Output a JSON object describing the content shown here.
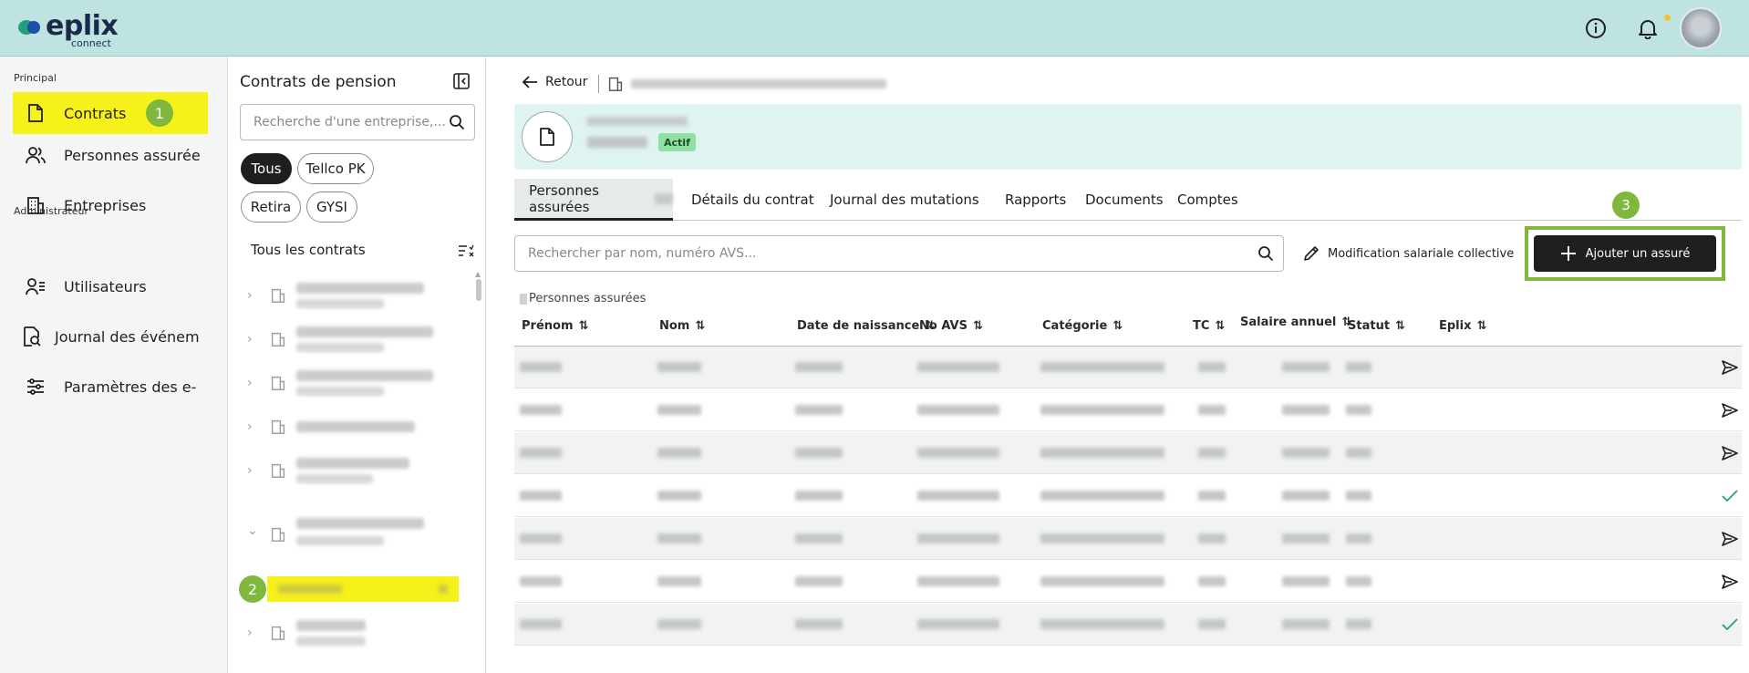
{
  "header": {
    "brand_name": "eplix",
    "brand_sub": "connect",
    "icons": [
      "info-icon",
      "bell-icon",
      "user-avatar"
    ]
  },
  "sidebar": {
    "sections": [
      {
        "label": "Principal"
      },
      {
        "label": "Administrateur"
      }
    ],
    "items": [
      {
        "label": "Contrats",
        "icon": "document-icon",
        "active": true
      },
      {
        "label": "Personnes assurée",
        "icon": "people-icon"
      },
      {
        "label": "Entreprises",
        "icon": "building-icon"
      },
      {
        "label": "Utilisateurs",
        "icon": "users-list-icon"
      },
      {
        "label": "Journal des événem",
        "icon": "log-icon"
      },
      {
        "label": "Paramètres des e-",
        "icon": "sliders-icon"
      }
    ],
    "step_badge": "1"
  },
  "contracts_panel": {
    "title": "Contrats de pension",
    "search_placeholder": "Recherche d'une entreprise,...",
    "filters": [
      "Tous",
      "Tellco PK",
      "Retira",
      "GYSI"
    ],
    "active_filter": "Tous",
    "list_title": "Tous les contrats",
    "step_badge": "2"
  },
  "main": {
    "back_label": "Retour",
    "status_badge": "Actif",
    "tabs": [
      "Personnes assurées",
      "Détails du contrat",
      "Journal des mutations",
      "Rapports",
      "Documents",
      "Comptes"
    ],
    "search_placeholder": "Rechercher par nom, numéro AVS...",
    "collective_salary_label": "Modification salariale collective",
    "add_button_label": "Ajouter un assuré",
    "step_badge": "3",
    "section_label": "Personnes assurées",
    "columns": [
      "Prénom",
      "Nom",
      "Date de naissance",
      "No AVS",
      "Catégorie",
      "TC",
      "Salaire annuel",
      "Statut",
      "Eplix"
    ],
    "row_status": [
      "send",
      "send",
      "send",
      "check",
      "send",
      "send",
      "check"
    ],
    "colors": {
      "accent_green": "#7fb83c",
      "highlight_yellow": "#f6f11a",
      "topbar": "#bfe3e1",
      "check_green": "#22a07a"
    }
  }
}
